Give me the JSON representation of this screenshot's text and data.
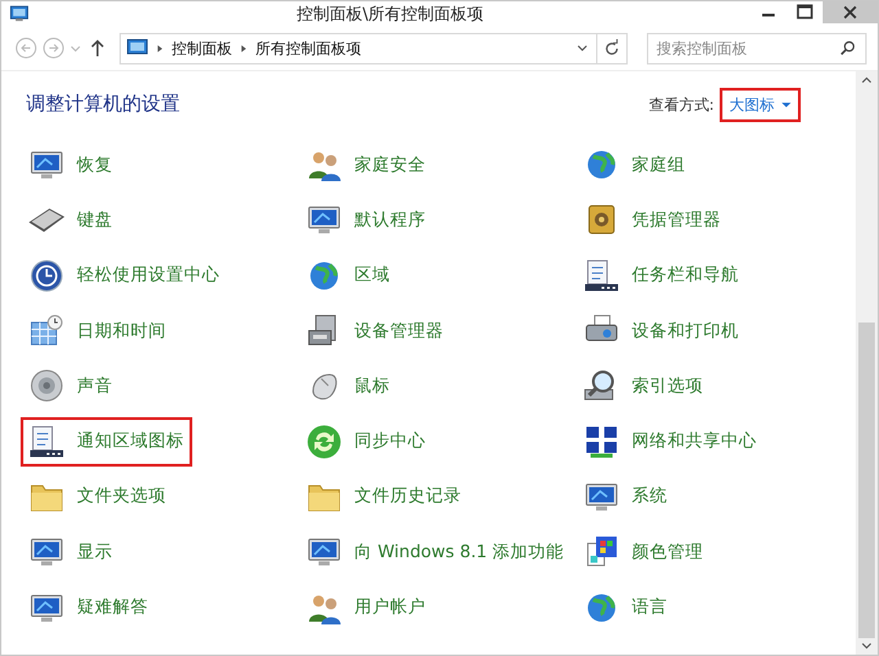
{
  "window": {
    "title": "控制面板\\所有控制面板项"
  },
  "address": {
    "crumbs": [
      "控制面板",
      "所有控制面板项"
    ]
  },
  "search": {
    "placeholder": "搜索控制面板"
  },
  "heading": "调整计算机的设置",
  "view": {
    "label": "查看方式:",
    "value": "大图标",
    "highlighted": true
  },
  "items": [
    {
      "label": "恢复",
      "highlighted": false
    },
    {
      "label": "家庭安全",
      "highlighted": false
    },
    {
      "label": "家庭组",
      "highlighted": false
    },
    {
      "label": "键盘",
      "highlighted": false
    },
    {
      "label": "默认程序",
      "highlighted": false
    },
    {
      "label": "凭据管理器",
      "highlighted": false
    },
    {
      "label": "轻松使用设置中心",
      "highlighted": false
    },
    {
      "label": "区域",
      "highlighted": false
    },
    {
      "label": "任务栏和导航",
      "highlighted": false
    },
    {
      "label": "日期和时间",
      "highlighted": false
    },
    {
      "label": "设备管理器",
      "highlighted": false
    },
    {
      "label": "设备和打印机",
      "highlighted": false
    },
    {
      "label": "声音",
      "highlighted": false
    },
    {
      "label": "鼠标",
      "highlighted": false
    },
    {
      "label": "索引选项",
      "highlighted": false
    },
    {
      "label": "通知区域图标",
      "highlighted": true
    },
    {
      "label": "同步中心",
      "highlighted": false
    },
    {
      "label": "网络和共享中心",
      "highlighted": false
    },
    {
      "label": "文件夹选项",
      "highlighted": false
    },
    {
      "label": "文件历史记录",
      "highlighted": false
    },
    {
      "label": "系统",
      "highlighted": false
    },
    {
      "label": "显示",
      "highlighted": false
    },
    {
      "label": "向 Windows 8.1 添加功能",
      "highlighted": false
    },
    {
      "label": "颜色管理",
      "highlighted": false
    },
    {
      "label": "疑难解答",
      "highlighted": false
    },
    {
      "label": "用户帐户",
      "highlighted": false
    },
    {
      "label": "语言",
      "highlighted": false
    }
  ]
}
